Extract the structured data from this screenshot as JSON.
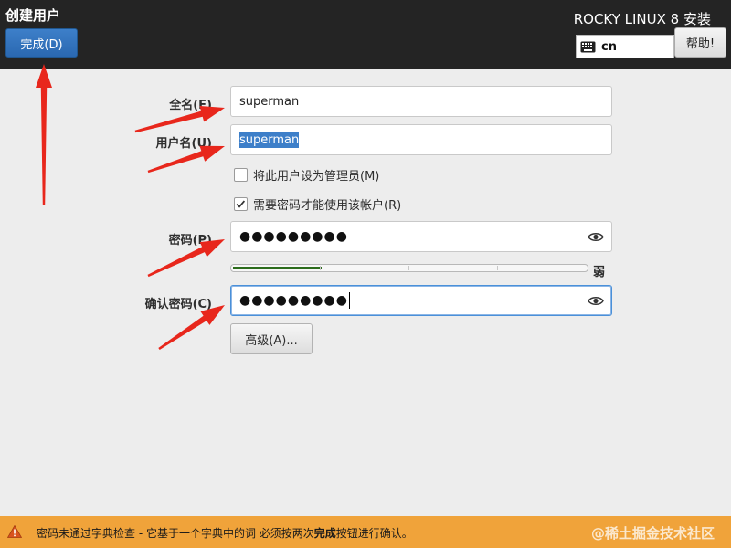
{
  "header": {
    "title": "创建用户",
    "done_label": "完成(D)",
    "install_title": "ROCKY LINUX 8 安装",
    "keyboard_layout": "cn",
    "help_label": "帮助!"
  },
  "form": {
    "fullname_label": "全名(F)",
    "fullname_value": "superman",
    "username_label": "用户名(U)",
    "username_value": "superman",
    "admin_checkbox_label": "将此用户设为管理员(M)",
    "admin_checked": false,
    "require_password_label": "需要密码才能使用该帐户(R)",
    "require_password_checked": true,
    "password_label": "密码(P)",
    "password_mask": "●●●●●●●●●",
    "password_strength": 0.25,
    "strength_text": "弱",
    "confirm_label": "确认密码(C)",
    "confirm_mask": "●●●●●●●●●",
    "advanced_label": "高级(A)..."
  },
  "footer": {
    "message_before": "密码未通过字典检查 - 它基于一个字典中的词 必须按两次",
    "message_bold": "完成",
    "message_after": "按钮进行确认。",
    "watermark": "@稀土掘金技术社区"
  },
  "colors": {
    "header_bg": "#242424",
    "accent_blue": "#3d7fc9",
    "footer_bg": "#f0a33a",
    "strength_green": "#2c6c1c",
    "arrow_red": "#e8271c"
  },
  "icons": {
    "keyboard": "keyboard-icon",
    "eye": "eye-icon",
    "warning": "warning-icon",
    "check": "check-icon"
  }
}
